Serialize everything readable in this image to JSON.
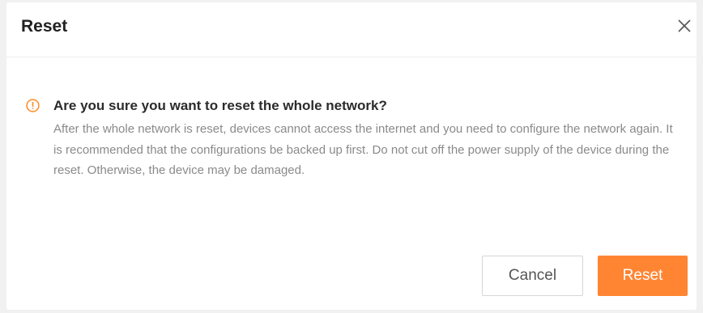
{
  "dialog": {
    "title": "Reset",
    "close_icon": "close-icon",
    "warning_icon": "warning-circle-icon",
    "question": "Are you sure you want to reset the whole network?",
    "message": "After the whole network is reset, devices cannot access the internet and you need to configure the network again. It is recommended that the configurations be backed up first. Do not cut off the power supply of the device during the reset. Otherwise, the device may be damaged.",
    "cancel_label": "Cancel",
    "reset_label": "Reset"
  },
  "colors": {
    "accent": "#ff8533",
    "warning": "#ff8a1f",
    "overlay": "#f1f1f1"
  }
}
